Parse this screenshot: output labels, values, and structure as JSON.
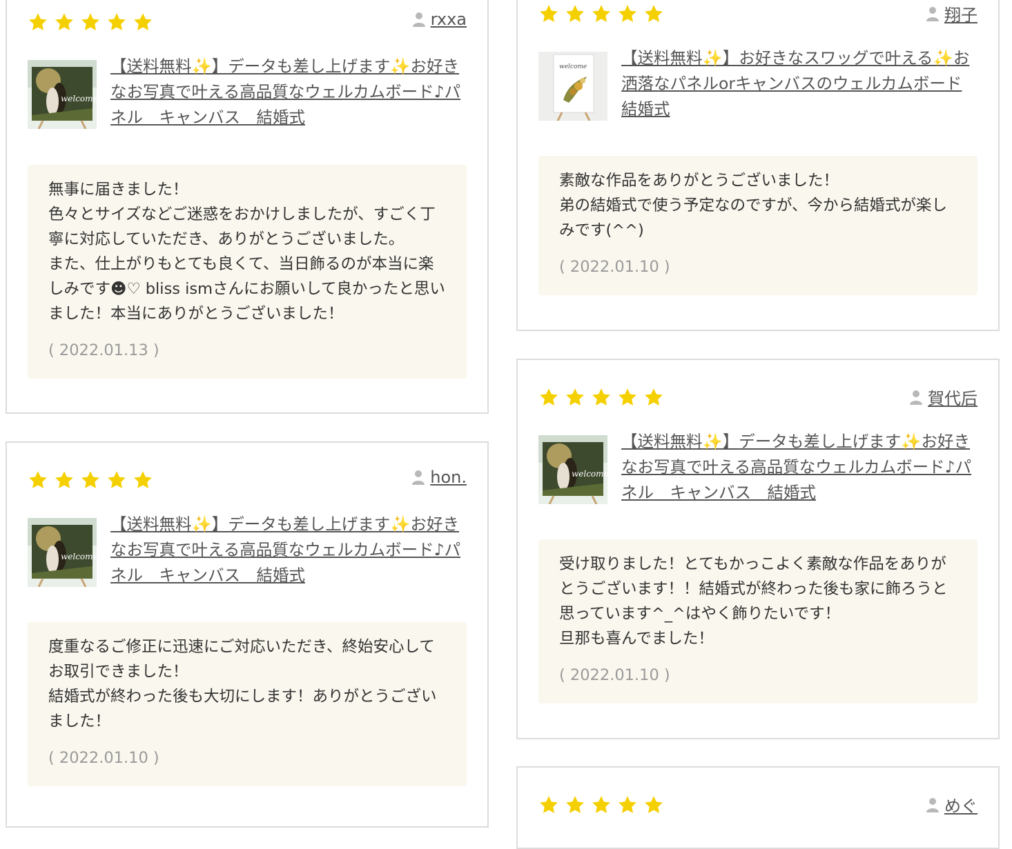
{
  "reviews": [
    {
      "rating": 5,
      "user": "rxxa",
      "product": "【送料無料✨】データも差し上げます✨お好きなお写真で叶える高品質なウェルカムボード♪パネル　キャンバス　結婚式",
      "thumb_type": "photo",
      "comment": "無事に届きました！\n色々とサイズなどご迷惑をおかけしましたが、すごく丁寧に対応していただき、ありがとうございました。\nまた、仕上がりもとても良くて、当日飾るのが本当に楽しみです☻♡ bliss ismさんにお願いして良かったと思いました！本当にありがとうございました！",
      "date": "( 2022.01.13 )"
    },
    {
      "rating": 5,
      "user": "hon.",
      "product": "【送料無料✨】データも差し上げます✨お好きなお写真で叶える高品質なウェルカムボード♪パネル　キャンバス　結婚式",
      "thumb_type": "photo",
      "comment": "度重なるご修正に迅速にご対応いただき、終始安心してお取引できました！\n結婚式が終わった後も大切にします！ありがとうございました！",
      "date": "( 2022.01.10 )"
    },
    {
      "rating": 5,
      "user": "翔子",
      "product": "【送料無料✨】お好きなスワッグで叶える✨お洒落なパネルorキャンバスのウェルカムボード 結婚式",
      "thumb_type": "swag",
      "comment": "素敵な作品をありがとうございました！\n弟の結婚式で使う予定なのですが、今から結婚式が楽しみです(^^)",
      "date": "( 2022.01.10 )"
    },
    {
      "rating": 5,
      "user": "賀代后",
      "product": "【送料無料✨】データも差し上げます✨お好きなお写真で叶える高品質なウェルカムボード♪パネル　キャンバス　結婚式",
      "thumb_type": "photo",
      "comment": "受け取りました！とてもかっこよく素敵な作品をありがとうございます！！結婚式が終わった後も家に飾ろうと思っています^_^はやく飾りたいです！\n旦那も喜んでました！",
      "date": "( 2022.01.10 )"
    },
    {
      "rating": 5,
      "user": "めぐ"
    }
  ],
  "thumb_texts": {
    "photo_script": "welcome",
    "swag_script": "welcome"
  },
  "colors": {
    "star": "#f5d000",
    "card_border": "#dcdcdc",
    "comment_bg": "#faf7ee",
    "date": "#9a9a9a"
  }
}
